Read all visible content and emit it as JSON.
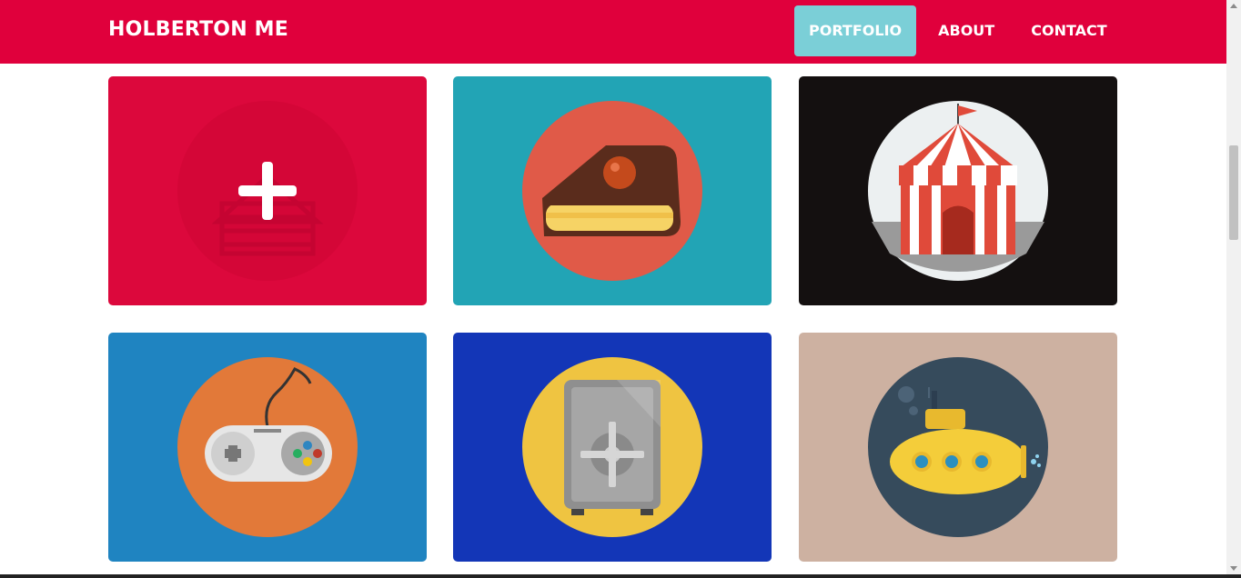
{
  "header": {
    "brand": "HOLBERTON ME",
    "bg_color": "#e0003c",
    "nav": [
      {
        "label": "PORTFOLIO",
        "active": true
      },
      {
        "label": "ABOUT",
        "active": false
      },
      {
        "label": "CONTACT",
        "active": false
      }
    ],
    "active_color": "#7bcfd7"
  },
  "portfolio": {
    "items": [
      {
        "icon": "log-cabin-icon",
        "bg": "#dc083c",
        "circle": "#d40637",
        "hover_overlay": "plus-icon"
      },
      {
        "icon": "cake-slice-icon",
        "bg": "#22a4b5",
        "circle": "#e05a48"
      },
      {
        "icon": "circus-tent-icon",
        "bg": "#141010",
        "circle": "#ecf0f1"
      },
      {
        "icon": "game-controller-icon",
        "bg": "#1f84c1",
        "circle": "#e27939"
      },
      {
        "icon": "safe-icon",
        "bg": "#1336b7",
        "circle": "#efc441"
      },
      {
        "icon": "submarine-icon",
        "bg": "#cdb1a1",
        "circle": "#364b5c"
      }
    ]
  }
}
